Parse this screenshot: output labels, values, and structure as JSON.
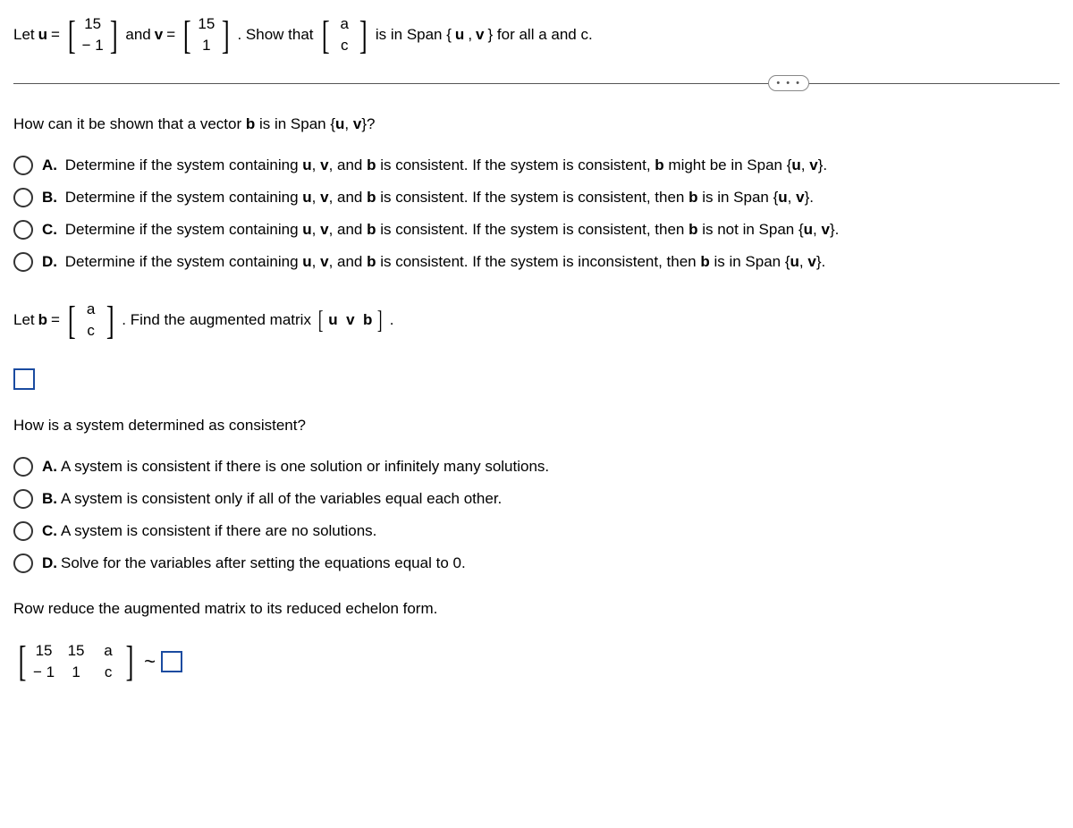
{
  "problem": {
    "let_u": "Let ",
    "u_var": "u",
    "equals": " = ",
    "u_matrix": [
      "15",
      "− 1"
    ],
    "and_v": " and ",
    "v_var": "v",
    "v_matrix": [
      "15",
      "1"
    ],
    "show_that": ". Show that ",
    "ac_matrix": [
      "a",
      "c"
    ],
    "span_text1": " is in Span {",
    "span_u": "u",
    "span_comma": ", ",
    "span_v": "v",
    "span_text2": "} for all a and c."
  },
  "q1": {
    "text1": "How can it be shown that a vector ",
    "b": "b",
    "text2": " is in Span {",
    "u": "u",
    "comma": ", ",
    "v": "v",
    "text3": "}?",
    "options": {
      "A": {
        "label": "A.",
        "pre": "Determine if the system containing ",
        "u": "u",
        "c1": ", ",
        "v": "v",
        "c2": ", and ",
        "b": "b",
        "mid": " is consistent. If the system is consistent, ",
        "b2": "b",
        "post": " might be in Span {",
        "su": "u",
        "sc": ", ",
        "sv": "v",
        "end": "}."
      },
      "B": {
        "label": "B.",
        "pre": "Determine if the system containing ",
        "u": "u",
        "c1": ", ",
        "v": "v",
        "c2": ", and ",
        "b": "b",
        "mid": " is consistent. If the system is consistent, then ",
        "b2": "b",
        "post": " is in Span {",
        "su": "u",
        "sc": ", ",
        "sv": "v",
        "end": "}."
      },
      "C": {
        "label": "C.",
        "pre": "Determine if the system containing ",
        "u": "u",
        "c1": ", ",
        "v": "v",
        "c2": ", and ",
        "b": "b",
        "mid": " is consistent. If the system is consistent, then ",
        "b2": "b",
        "post": " is not in Span {",
        "su": "u",
        "sc": ", ",
        "sv": "v",
        "end": "}."
      },
      "D": {
        "label": "D.",
        "pre": "Determine if the system containing ",
        "u": "u",
        "c1": ", ",
        "v": "v",
        "c2": ", and ",
        "b": "b",
        "mid": " is consistent. If the system is inconsistent, then ",
        "b2": "b",
        "post": " is in Span {",
        "su": "u",
        "sc": ", ",
        "sv": "v",
        "end": "}."
      }
    }
  },
  "letb": {
    "let": "Let ",
    "b": "b",
    "eq": " = ",
    "matrix": [
      "a",
      "c"
    ],
    "find": ". Find the augmented matrix ",
    "aug_u": "u",
    "aug_v": "v",
    "aug_b": "b",
    "period": "."
  },
  "q2": {
    "text": "How is a system determined as consistent?",
    "options": {
      "A": {
        "label": "A.",
        "text": "A system is consistent if there is one solution or infinitely many solutions."
      },
      "B": {
        "label": "B.",
        "text": "A system is consistent only if all of the variables equal each other."
      },
      "C": {
        "label": "C.",
        "text": "A system is consistent if there are no solutions."
      },
      "D": {
        "label": "D.",
        "text": "Solve for the variables after setting the equations equal to 0."
      }
    }
  },
  "rowreduce": {
    "text": "Row reduce the augmented matrix to its reduced echelon form.",
    "matrix": [
      [
        "15",
        "15",
        "a"
      ],
      [
        "− 1",
        "1",
        "c"
      ]
    ],
    "tilde": "~"
  },
  "dots": "• • •"
}
